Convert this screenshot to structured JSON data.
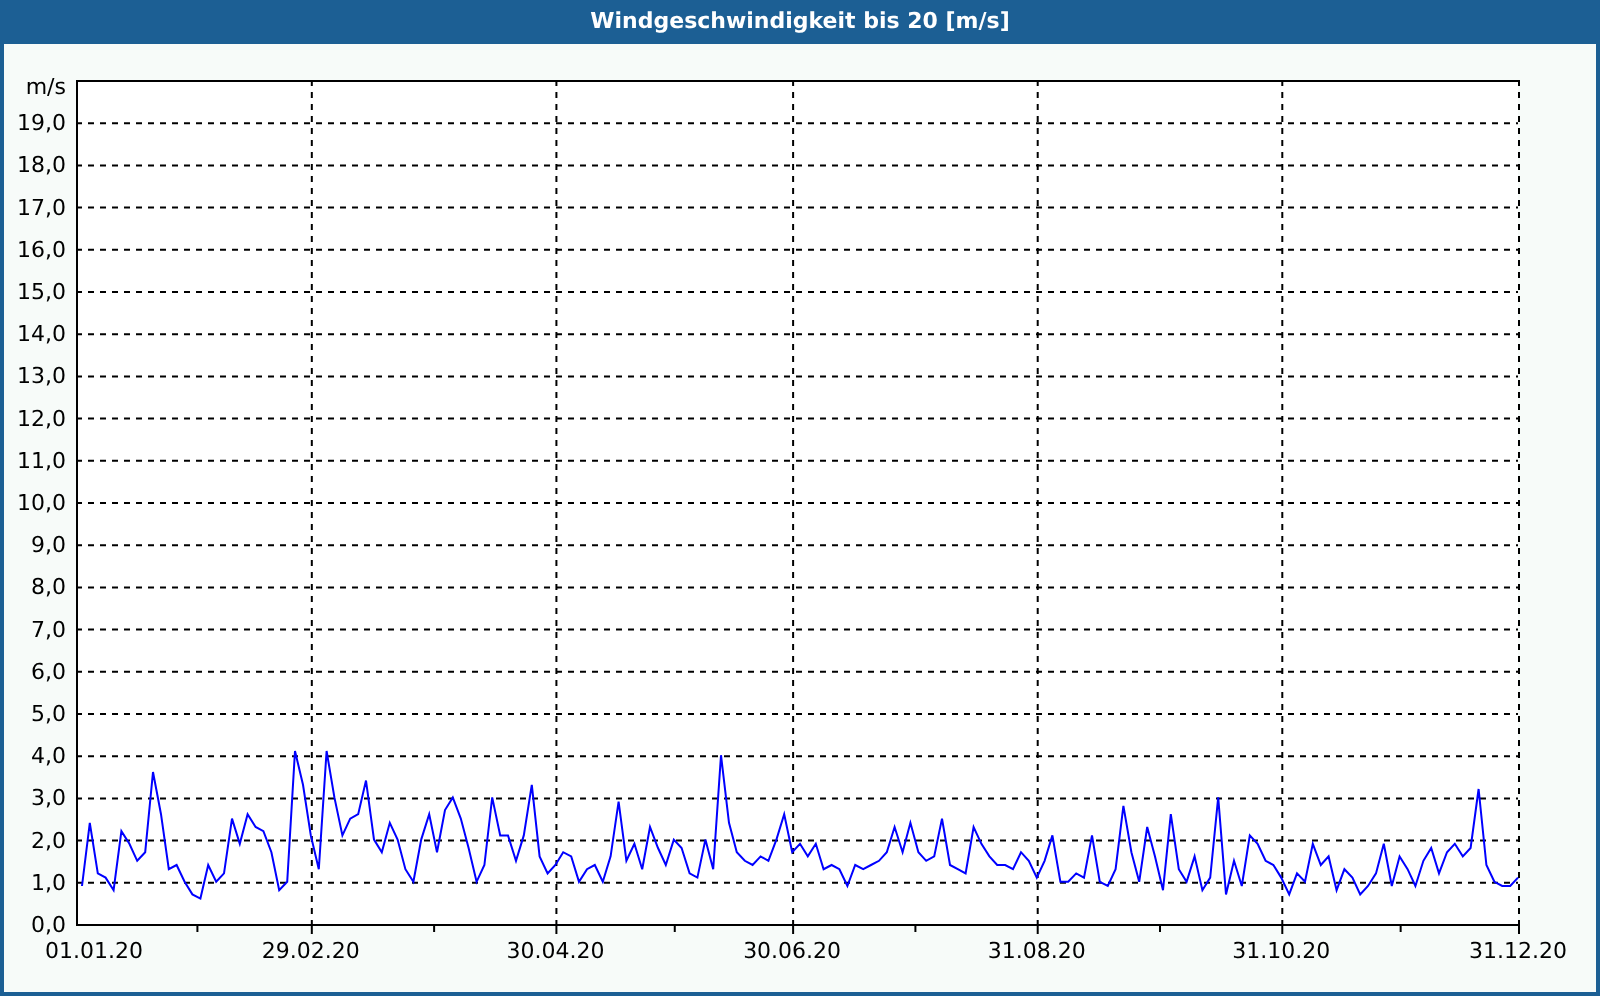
{
  "window": {
    "title": "Windgeschwindigkeit bis 20 [m/s]"
  },
  "chart_data": {
    "type": "line",
    "grid": true,
    "ylabel": "m/s",
    "ylim": [
      0,
      20
    ],
    "yticks": [
      {
        "value": 19,
        "label": "19,0"
      },
      {
        "value": 18,
        "label": "18,0"
      },
      {
        "value": 17,
        "label": "17,0"
      },
      {
        "value": 16,
        "label": "16,0"
      },
      {
        "value": 15,
        "label": "15,0"
      },
      {
        "value": 14,
        "label": "14,0"
      },
      {
        "value": 13,
        "label": "13,0"
      },
      {
        "value": 12,
        "label": "12,0"
      },
      {
        "value": 11,
        "label": "11,0"
      },
      {
        "value": 10,
        "label": "10,0"
      },
      {
        "value": 9,
        "label": "9,0"
      },
      {
        "value": 8,
        "label": "8,0"
      },
      {
        "value": 7,
        "label": "7,0"
      },
      {
        "value": 6,
        "label": "6,0"
      },
      {
        "value": 5,
        "label": "5,0"
      },
      {
        "value": 4,
        "label": "4,0"
      },
      {
        "value": 3,
        "label": "3,0"
      },
      {
        "value": 2,
        "label": "2,0"
      },
      {
        "value": 1,
        "label": "1,0"
      },
      {
        "value": 0,
        "label": "0,0"
      }
    ],
    "categories": [
      "01.01.20",
      null,
      null,
      null,
      null,
      null,
      null,
      null,
      null,
      null,
      null,
      null,
      null,
      null,
      null,
      null,
      null,
      null,
      null,
      null,
      null,
      null,
      null,
      null,
      null,
      null,
      null,
      null,
      null,
      "29.02.20",
      null,
      null,
      null,
      null,
      null,
      null,
      null,
      null,
      null,
      null,
      null,
      null,
      null,
      null,
      null,
      null,
      null,
      null,
      null,
      null,
      null,
      null,
      null,
      null,
      null,
      null,
      null,
      null,
      null,
      null,
      "30.04.20",
      null,
      null,
      null,
      null,
      null,
      null,
      null,
      null,
      null,
      null,
      null,
      null,
      null,
      null,
      null,
      null,
      null,
      null,
      null,
      null,
      null,
      null,
      null,
      null,
      null,
      null,
      null,
      null,
      null,
      "30.06.20",
      null,
      null,
      null,
      null,
      null,
      null,
      null,
      null,
      null,
      null,
      null,
      null,
      null,
      null,
      null,
      null,
      null,
      null,
      null,
      null,
      null,
      null,
      null,
      null,
      null,
      null,
      null,
      null,
      null,
      null,
      "31.08.20",
      null,
      null,
      null,
      null,
      null,
      null,
      null,
      null,
      null,
      null,
      null,
      null,
      null,
      null,
      null,
      null,
      null,
      null,
      null,
      null,
      null,
      null,
      null,
      null,
      null,
      null,
      null,
      null,
      null,
      null,
      "31.10.20",
      null,
      null,
      null,
      null,
      null,
      null,
      null,
      null,
      null,
      null,
      null,
      null,
      null,
      null,
      null,
      null,
      null,
      null,
      null,
      null,
      null,
      null,
      null,
      null,
      null,
      null,
      null,
      null,
      null,
      "31.12.20"
    ],
    "series": [
      {
        "color": "#0000ff",
        "values": [
          0.9,
          2.4,
          1.2,
          1.1,
          0.8,
          2.2,
          1.9,
          1.5,
          1.7,
          3.6,
          2.6,
          1.3,
          1.4,
          1.0,
          0.7,
          0.6,
          1.4,
          1.0,
          1.2,
          2.5,
          1.9,
          2.6,
          2.3,
          2.2,
          1.7,
          0.8,
          1.0,
          4.1,
          3.3,
          2.1,
          1.3,
          4.1,
          3.0,
          2.1,
          2.5,
          2.6,
          3.4,
          2.0,
          1.7,
          2.4,
          2.0,
          1.3,
          1.0,
          2.0,
          2.6,
          1.7,
          2.7,
          3.0,
          2.5,
          1.8,
          1.0,
          1.4,
          3.0,
          2.1,
          2.1,
          1.5,
          2.1,
          3.3,
          1.6,
          1.2,
          1.4,
          1.7,
          1.6,
          1.0,
          1.3,
          1.4,
          1.0,
          1.6,
          2.9,
          1.5,
          1.9,
          1.3,
          2.3,
          1.8,
          1.4,
          2.0,
          1.8,
          1.2,
          1.1,
          2.0,
          1.3,
          4.0,
          2.4,
          1.7,
          1.5,
          1.4,
          1.6,
          1.5,
          2.0,
          2.6,
          1.7,
          1.9,
          1.6,
          1.9,
          1.3,
          1.4,
          1.3,
          0.9,
          1.4,
          1.3,
          1.4,
          1.5,
          1.7,
          2.3,
          1.7,
          2.4,
          1.7,
          1.5,
          1.6,
          2.5,
          1.4,
          1.3,
          1.2,
          2.3,
          1.9,
          1.6,
          1.4,
          1.4,
          1.3,
          1.7,
          1.5,
          1.1,
          1.5,
          2.1,
          1.0,
          1.0,
          1.2,
          1.1,
          2.1,
          1.0,
          0.9,
          1.3,
          2.8,
          1.7,
          1.0,
          2.3,
          1.6,
          0.8,
          2.6,
          1.3,
          1.0,
          1.6,
          0.8,
          1.1,
          3.0,
          0.7,
          1.5,
          0.9,
          2.1,
          1.9,
          1.5,
          1.4,
          1.1,
          0.7,
          1.2,
          1.0,
          1.9,
          1.4,
          1.6,
          0.8,
          1.3,
          1.1,
          0.7,
          0.9,
          1.2,
          1.9,
          0.9,
          1.6,
          1.3,
          0.9,
          1.5,
          1.8,
          1.2,
          1.7,
          1.9,
          1.6,
          1.8,
          3.2,
          1.4,
          1.0,
          0.9,
          0.9,
          1.1
        ]
      }
    ]
  }
}
